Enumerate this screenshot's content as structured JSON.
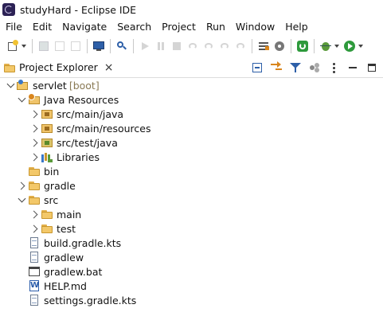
{
  "window": {
    "title": "studyHard - Eclipse IDE"
  },
  "menu": [
    "File",
    "Edit",
    "Navigate",
    "Search",
    "Project",
    "Run",
    "Window",
    "Help"
  ],
  "view": {
    "tab_label": "Project Explorer",
    "close_glyph": "×"
  },
  "tree": {
    "project": {
      "label": "servlet",
      "decoration": "[boot]"
    },
    "java_resources": {
      "label": "Java Resources"
    },
    "src_main_java": {
      "label": "src/main/java"
    },
    "src_main_resources": {
      "label": "src/main/resources"
    },
    "src_test_java": {
      "label": "src/test/java"
    },
    "libraries": {
      "label": "Libraries"
    },
    "bin": {
      "label": "bin"
    },
    "gradle": {
      "label": "gradle"
    },
    "src": {
      "label": "src"
    },
    "main": {
      "label": "main"
    },
    "test": {
      "label": "test"
    },
    "build_gradle_kts": {
      "label": "build.gradle.kts"
    },
    "gradlew": {
      "label": "gradlew"
    },
    "gradlew_bat": {
      "label": "gradlew.bat"
    },
    "help_md": {
      "label": "HELP.md"
    },
    "settings_gradle_kts": {
      "label": "settings.gradle.kts"
    }
  }
}
